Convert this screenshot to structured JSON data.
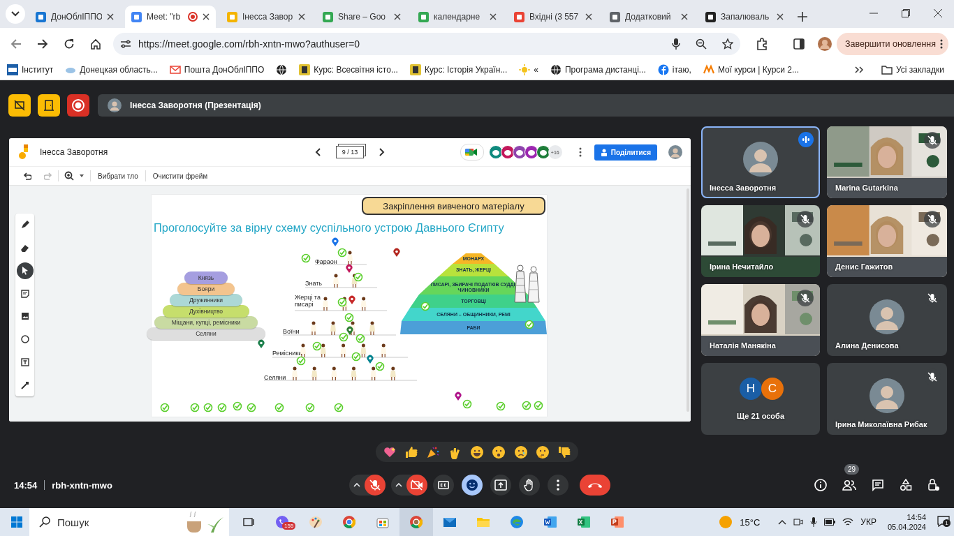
{
  "browser": {
    "tabs": [
      {
        "label": "ДонОблІППО",
        "selected": false,
        "recording": false
      },
      {
        "label": "Meet: \"rb",
        "selected": true,
        "recording": true
      },
      {
        "label": "Інесса Завор",
        "selected": false,
        "recording": false
      },
      {
        "label": "Share – Goo",
        "selected": false,
        "recording": false
      },
      {
        "label": "календарне",
        "selected": false,
        "recording": false
      },
      {
        "label": "Вхідні (3 557",
        "selected": false,
        "recording": false
      },
      {
        "label": "Додатковий",
        "selected": false,
        "recording": false
      },
      {
        "label": "Запалюваль",
        "selected": false,
        "recording": false
      }
    ],
    "url": "https://meet.google.com/rbh-xntn-mwo?authuser=0",
    "update_button": "Завершити оновлення",
    "bookmarks": [
      "Інститут",
      "Донецкая область...",
      "Пошта ДонОблІППО",
      "Курс: Всесвітня істо...",
      "Курс: Історія Україн...",
      "«",
      "Програма дистанці...",
      "ітаю,",
      "Мої курси | Курси 2..."
    ],
    "all_bookmarks": "Усі закладки"
  },
  "presenter": "Інесса Заворотня (Презентація)",
  "jamboard": {
    "title": "Інесса Заворотня",
    "page": "9 / 13",
    "more_collaborators": "+16",
    "share_button": "Поділитися",
    "toolbar": [
      "Вибрати тло",
      "Очистити фрейм"
    ],
    "slide": {
      "header": "Закріплення вивченого матеріалу",
      "title": "Проголосуйте за вірну схему суспільного устрою Давнього Єгипту",
      "left_pyramid": [
        {
          "label": "Князь",
          "color": "#a59ee0"
        },
        {
          "label": "Бояри",
          "color": "#f3c48e"
        },
        {
          "label": "Дружинники",
          "color": "#acd8d6"
        },
        {
          "label": "Духівництво",
          "color": "#c6de6c"
        },
        {
          "label": "Міщани, купці, ремісники",
          "color": "#c9dba2"
        },
        {
          "label": "Селяни",
          "color": "#dedede"
        }
      ],
      "middle_tiers": [
        "Фараон",
        "Знать",
        "Жерці та писарі",
        "Воїни",
        "Ремісники",
        "Селяни"
      ],
      "right_pyramid": [
        {
          "label": "МОНАРХ",
          "color": "#f6b626"
        },
        {
          "label": "ЗНАТЬ, ЖЕРЦІ",
          "color": "#b8e23c"
        },
        {
          "label": "ПИСАРІ, ЗБИРАЧІ ПОДАТКІВ СУДДІ, ЧИНОВНИКИ",
          "color": "#66d65a"
        },
        {
          "label": "ТОРГОВЦІ",
          "color": "#3fd18a"
        },
        {
          "label": "СЕЛЯНИ – ОБЩИННИКИ, РЕМІ",
          "color": "#43d6cb"
        },
        {
          "label": "РАБИ",
          "color": "#4c9fd8"
        }
      ]
    }
  },
  "participants": [
    {
      "kind": "avatar",
      "name": "Інесса Заворотня",
      "speaking": true,
      "muted": false
    },
    {
      "kind": "video",
      "name": "Marina Gutarkina",
      "speaking": false,
      "muted": true
    },
    {
      "kind": "video",
      "name": "Ірина Нечитайло",
      "speaking": false,
      "muted": true
    },
    {
      "kind": "video",
      "name": "Денис Гажитов",
      "speaking": false,
      "muted": true
    },
    {
      "kind": "video",
      "name": "Наталія Манякіна",
      "speaking": false,
      "muted": true
    },
    {
      "kind": "avatar",
      "name": "Алина Денисова",
      "speaking": false,
      "muted": true
    },
    {
      "kind": "more",
      "name": "Ще 21 особа",
      "speaking": false,
      "muted": false,
      "avatars": [
        {
          "letter": "Н",
          "color": "#1a5ea6"
        },
        {
          "letter": "С",
          "color": "#e8710a"
        }
      ]
    },
    {
      "kind": "avatar",
      "name": "Ірина Миколаївна Рибак",
      "speaking": false,
      "muted": true
    }
  ],
  "meeting": {
    "time": "14:54",
    "code": "rbh-xntn-mwo",
    "mic_on": false,
    "camera_on": false,
    "reactions_open": true,
    "people_count": "29"
  },
  "taskbar": {
    "search_placeholder": "Пошук",
    "viber_badge": "155",
    "weather": "15°C",
    "language": "УКР",
    "time": "14:54",
    "date": "05.04.2024",
    "notifications": "1"
  }
}
